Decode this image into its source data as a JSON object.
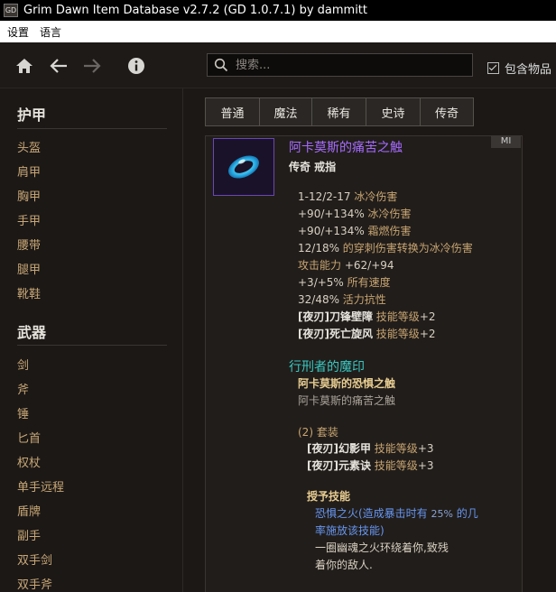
{
  "window": {
    "title": "Grim Dawn Item Database v2.7.2 (GD 1.0.7.1) by dammitt",
    "icon_text": "GD"
  },
  "menu": {
    "items": [
      "设置",
      "语言"
    ]
  },
  "toolbar": {
    "search_placeholder": "搜索...",
    "include_items_label": "包含物品"
  },
  "sidebar": {
    "armor_title": "护甲",
    "armor_items": [
      "头盔",
      "肩甲",
      "胸甲",
      "手甲",
      "腰带",
      "腿甲",
      "靴鞋"
    ],
    "weapons_title": "武器",
    "weapon_items": [
      "剑",
      "斧",
      "锤",
      "匕首",
      "权杖",
      "单手远程",
      "盾牌",
      "副手",
      "双手剑",
      "双手斧"
    ]
  },
  "tabs": [
    "普通",
    "魔法",
    "稀有",
    "史诗",
    "传奇"
  ],
  "item": {
    "badge": "MI",
    "name": "阿卡莫斯的痛苦之触",
    "type": "传奇 戒指",
    "stats": [
      {
        "pre": "1-12/2-17",
        "text": " 冰冷伤害"
      },
      {
        "pre": "+90/+134%",
        "text": " 冰冷伤害"
      },
      {
        "pre": "+90/+134%",
        "text": " 霜燃伤害"
      },
      {
        "pre": "12/18%",
        "text": " 的穿刺伤害转换为冰冷伤害"
      },
      {
        "pre": "攻击能力",
        "text": " +62/+94",
        "swap": true
      },
      {
        "pre": "+3/+5%",
        "text": " 所有速度"
      },
      {
        "pre": "32/48%",
        "text": " 活力抗性"
      }
    ],
    "skill_lines": [
      {
        "name": "[夜刃]刀锋壁障",
        "label": " 技能等级",
        "value": "+2"
      },
      {
        "name": "[夜刃]死亡旋风",
        "label": " 技能等级",
        "value": "+2"
      }
    ],
    "set": {
      "title": "行刑者的魔印",
      "members": [
        "阿卡莫斯的恐惧之触",
        "阿卡莫斯的痛苦之触"
      ],
      "bonus_header": "(2) 套装",
      "bonus_lines": [
        {
          "name": "[夜刃]幻影甲",
          "label": " 技能等级",
          "value": "+3"
        },
        {
          "name": "[夜刃]元素诀",
          "label": " 技能等级",
          "value": "+3"
        }
      ],
      "granted_label": "授予技能",
      "granted_skill_line1_a": "恐惧之火(造成暴击时有 ",
      "granted_skill_pct": "25%",
      "granted_skill_line1_b": " 的几",
      "granted_skill_line2": "率施放该技能)",
      "desc_line1": "一圈幽魂之火环绕着你,致残",
      "desc_line2": "着你的敌人."
    }
  },
  "colors": {
    "legendary": "#a66bff",
    "set": "#37c8c2",
    "skill": "#6796f1",
    "stat_text": "#c8a572"
  }
}
